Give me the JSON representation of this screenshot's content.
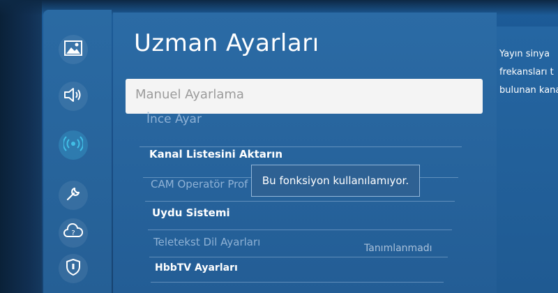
{
  "page": {
    "title": "Uzman Ayarları"
  },
  "sidebar": {
    "items": [
      {
        "name": "picture-icon",
        "active": false
      },
      {
        "name": "sound-icon",
        "active": false
      },
      {
        "name": "broadcast-icon",
        "active": true
      },
      {
        "name": "wrench-icon",
        "active": false
      },
      {
        "name": "support-icon",
        "active": false
      },
      {
        "name": "privacy-shield-icon",
        "active": false
      }
    ]
  },
  "menu": {
    "items": [
      {
        "label": "Manuel Ayarlama",
        "state": "focused"
      },
      {
        "label": "İnce Ayar",
        "state": "disabled"
      },
      {
        "label": "Kanal Listesini Aktarın",
        "state": "enabled"
      },
      {
        "label": "CAM Operatör Prof",
        "state": "disabled"
      },
      {
        "label": "Uydu Sistemi",
        "state": "enabled"
      },
      {
        "label": "Teletekst Dil Ayarları",
        "value": "Tanımlanmadı",
        "state": "disabled"
      },
      {
        "label": "HbbTV Ayarları",
        "state": "enabled"
      }
    ]
  },
  "tooltip": {
    "text": "Bu fonksiyon kullanılamıyor."
  },
  "description": {
    "lines": [
      "Yayın sinya",
      "frekansları t",
      "bulunan kana"
    ]
  },
  "colors": {
    "accent_active": "#41bee6",
    "panel": "#2b6ba5",
    "focused_row": "#f4f4f4",
    "focused_text": "#9b9b9b",
    "disabled_text": "#8fb2d6"
  }
}
